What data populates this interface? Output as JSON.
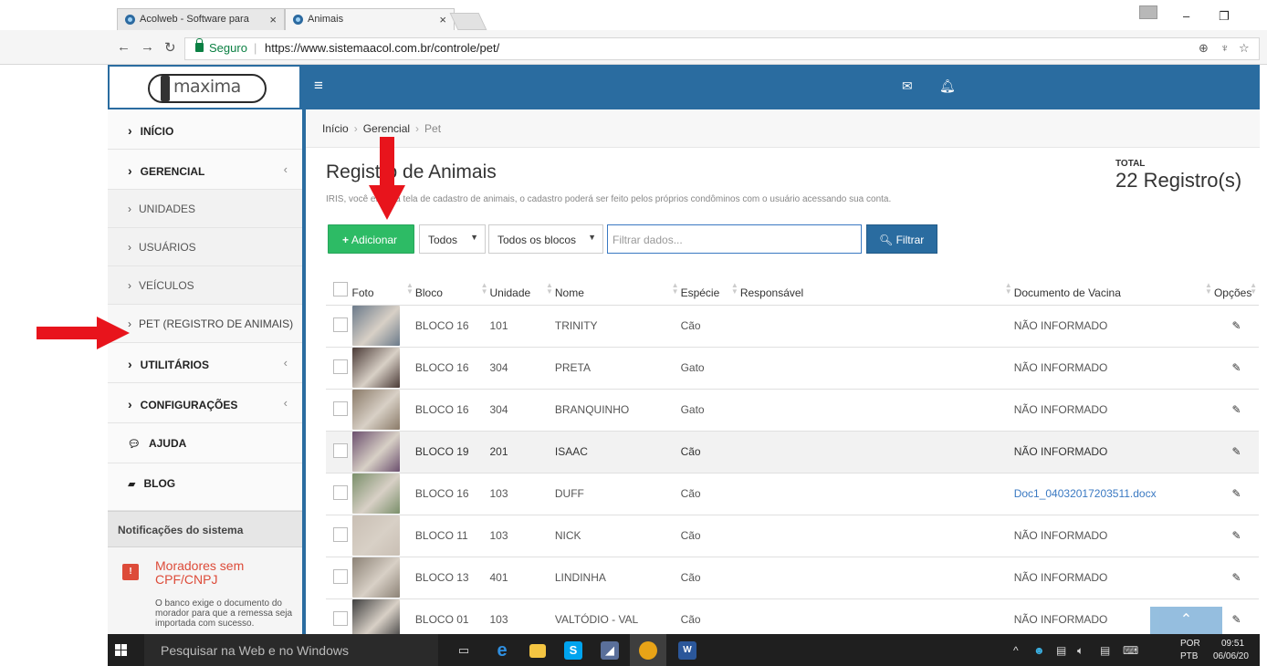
{
  "browser": {
    "tabs": [
      {
        "title": "Acolweb - Software para",
        "close": "×"
      },
      {
        "title": "Animais",
        "close": "×"
      }
    ],
    "secure_label": "Seguro",
    "url": "https://www.sistemaacol.com.br/controle/pet/"
  },
  "header": {
    "logo_text": "maxima"
  },
  "sidebar": {
    "inicio": "INÍCIO",
    "gerencial": "GERENCIAL",
    "unidades": "UNIDADES",
    "usuarios": "USUÁRIOS",
    "veiculos": "VEÍCULOS",
    "pet": "PET (REGISTRO DE ANIMAIS)",
    "utilitarios": "UTILITÁRIOS",
    "configuracoes": "CONFIGURAÇÕES",
    "ajuda": "AJUDA",
    "blog": "BLOG",
    "notifications_title": "Notificações do sistema",
    "notification": {
      "title": "Moradores sem CPF/CNPJ",
      "text": "O banco exige o documento do morador para que a remessa seja importada com sucesso."
    }
  },
  "breadcrumb": {
    "home": "Início",
    "section": "Gerencial",
    "current": "Pet"
  },
  "page": {
    "title": "Registro de Animais",
    "description": "IRIS, você está na tela de cadastro de animais, o cadastro poderá ser feito pelos próprios condôminos com o usuário acessando sua conta.",
    "total_label": "TOTAL",
    "total_value": "22 Registro(s)"
  },
  "toolbar": {
    "add_label": "Adicionar",
    "filter_status": "Todos",
    "filter_block": "Todos os blocos",
    "search_placeholder": "Filtrar dados...",
    "filter_button": "Filtrar"
  },
  "table": {
    "headers": [
      "Foto",
      "Bloco",
      "Unidade",
      "Nome",
      "Espécie",
      "Responsável",
      "Documento de Vacina",
      "Opções"
    ],
    "rows": [
      {
        "bloco": "BLOCO 16",
        "unidade": "101",
        "nome": "TRINITY",
        "especie": "Cão",
        "responsavel": "",
        "documento": "NÃO INFORMADO",
        "photo": "#6b7a8a"
      },
      {
        "bloco": "BLOCO 16",
        "unidade": "304",
        "nome": "PRETA",
        "especie": "Gato",
        "responsavel": "",
        "documento": "NÃO INFORMADO",
        "photo": "#4a3a36"
      },
      {
        "bloco": "BLOCO 16",
        "unidade": "304",
        "nome": "BRANQUINHO",
        "especie": "Gato",
        "responsavel": "",
        "documento": "NÃO INFORMADO",
        "photo": "#8a7a68"
      },
      {
        "bloco": "BLOCO 19",
        "unidade": "201",
        "nome": "ISAAC",
        "especie": "Cão",
        "responsavel": "",
        "documento": "NÃO INFORMADO",
        "photo": "#6b4f6e"
      },
      {
        "bloco": "BLOCO 16",
        "unidade": "103",
        "nome": "DUFF",
        "especie": "Cão",
        "responsavel": "",
        "documento": "Doc1_04032017203511.docx",
        "photo": "#7a8f6a"
      },
      {
        "bloco": "BLOCO 11",
        "unidade": "103",
        "nome": "NICK",
        "especie": "Cão",
        "responsavel": "",
        "documento": "NÃO INFORMADO",
        "photo": "#c9bfb4"
      },
      {
        "bloco": "BLOCO 13",
        "unidade": "401",
        "nome": "LINDINHA",
        "especie": "Cão",
        "responsavel": "",
        "documento": "NÃO INFORMADO",
        "photo": "#8c8276"
      },
      {
        "bloco": "BLOCO 01",
        "unidade": "103",
        "nome": "VALTÓDIO - VAL",
        "especie": "Cão",
        "responsavel": "",
        "documento": "NÃO INFORMADO",
        "photo": "#3f3f3f"
      }
    ]
  },
  "taskbar": {
    "search_placeholder": "Pesquisar na Web e no Windows",
    "lang1": "POR",
    "lang2": "PTB",
    "time": "09:51",
    "date": "06/06/20"
  },
  "colors": {
    "brand": "#2a6ca0",
    "add_button": "#2dbb65",
    "annotation_arrow": "#e8141c",
    "link": "#3a79c2"
  },
  "icons": [
    "menu-icon",
    "mail-icon",
    "bell-icon",
    "chevron-right-icon",
    "comments-icon",
    "blog-icon",
    "pencil-icon",
    "search-icon",
    "arrow-up-icon"
  ]
}
